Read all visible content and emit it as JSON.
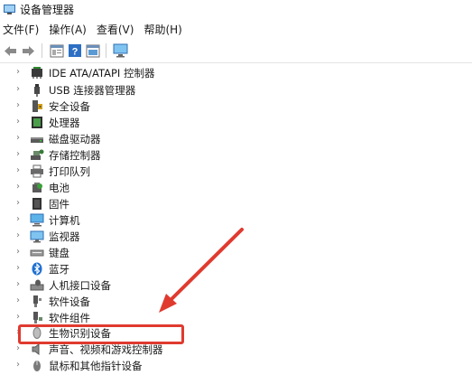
{
  "window": {
    "title": "设备管理器"
  },
  "menu": [
    "文件(F)",
    "操作(A)",
    "查看(V)",
    "帮助(H)"
  ],
  "toolbar": {
    "buttons": [
      "back-icon",
      "forward-icon",
      "properties-icon",
      "help-icon",
      "details-icon",
      "monitor-icon"
    ]
  },
  "tree": {
    "items": [
      {
        "label": "IDE ATA/ATAPI 控制器",
        "icon": "ide-controller-icon"
      },
      {
        "label": "USB 连接器管理器",
        "icon": "usb-connector-icon"
      },
      {
        "label": "安全设备",
        "icon": "security-device-icon"
      },
      {
        "label": "处理器",
        "icon": "processor-icon"
      },
      {
        "label": "磁盘驱动器",
        "icon": "disk-drive-icon"
      },
      {
        "label": "存储控制器",
        "icon": "storage-controller-icon"
      },
      {
        "label": "打印队列",
        "icon": "print-queue-icon"
      },
      {
        "label": "电池",
        "icon": "battery-icon"
      },
      {
        "label": "固件",
        "icon": "firmware-icon"
      },
      {
        "label": "计算机",
        "icon": "computer-icon"
      },
      {
        "label": "监视器",
        "icon": "monitor-icon"
      },
      {
        "label": "键盘",
        "icon": "keyboard-icon"
      },
      {
        "label": "蓝牙",
        "icon": "bluetooth-icon"
      },
      {
        "label": "人机接口设备",
        "icon": "hid-icon"
      },
      {
        "label": "软件设备",
        "icon": "software-device-icon"
      },
      {
        "label": "软件组件",
        "icon": "software-component-icon"
      },
      {
        "label": "生物识别设备",
        "icon": "biometric-icon"
      },
      {
        "label": "声音、视频和游戏控制器",
        "icon": "sound-icon"
      },
      {
        "label": "鼠标和其他指针设备",
        "icon": "mouse-icon"
      }
    ]
  },
  "annotation": {
    "color": "#e03a2f"
  }
}
